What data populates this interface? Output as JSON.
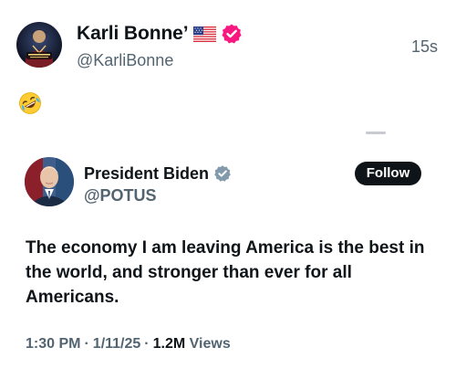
{
  "post": {
    "display_name": "Karli Bonne’",
    "handle": "@KarliBonne",
    "time": "15s",
    "avatar_icon": "profile-avatar",
    "flag_icon": "us-flag-icon",
    "verified_icon": "verified-badge-icon",
    "verified_color": "#f91880",
    "body_emoji": "🤣"
  },
  "quoted": {
    "display_name": "President Biden",
    "handle": "@POTUS",
    "verified_icon": "verified-badge-icon",
    "verified_color": "#829aab",
    "follow_label": "Follow",
    "text": "The economy I am leaving America is the best in the world, and stronger than ever for all Americans.",
    "time": "1:30 PM",
    "date": "1/11/25",
    "views_count": "1.2M",
    "views_label": "Views"
  }
}
